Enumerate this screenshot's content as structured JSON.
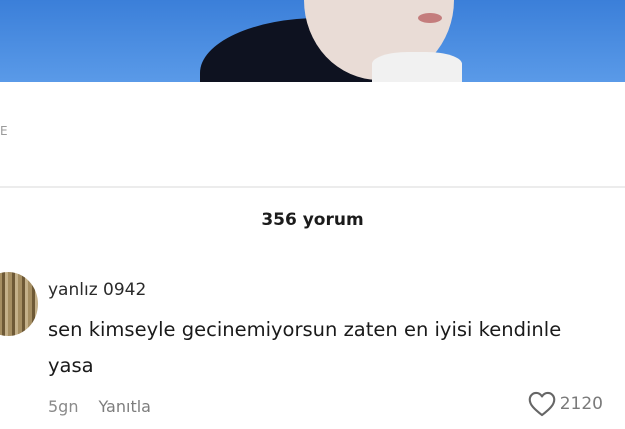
{
  "caption": {
    "glyph": "E"
  },
  "comments_header": {
    "count_label": "356 yorum"
  },
  "comment": {
    "username": "yanlız 0942",
    "text": "sen kimseyle gecinemiyorsun zaten en iyisi kendinle yasa",
    "age": "5gn",
    "reply_label": "Yanıtla",
    "like_count": "2120",
    "like_icon": "heart-outline-icon"
  }
}
